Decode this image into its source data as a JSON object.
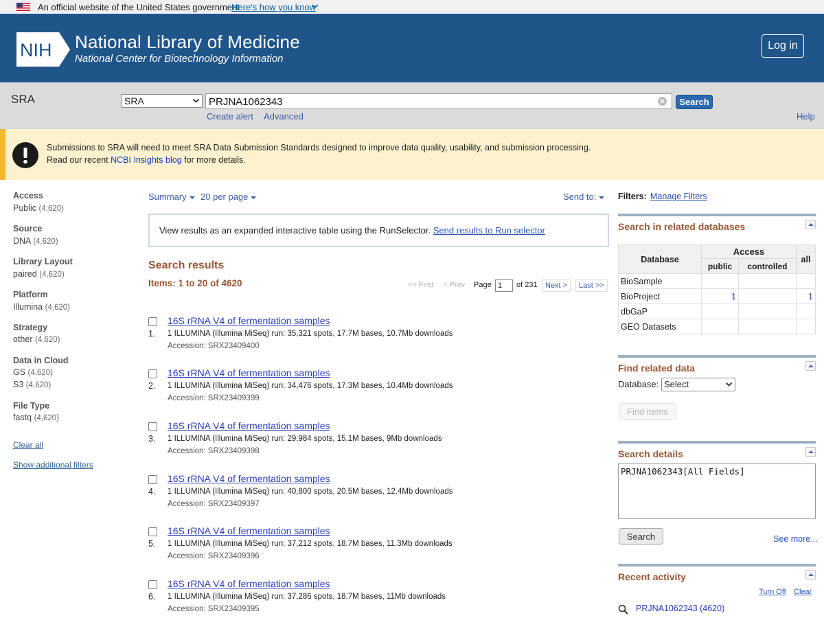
{
  "gov_banner": {
    "text": "An official website of the United States government",
    "link_text": "Here's how you know"
  },
  "header": {
    "logo_text": "NIH",
    "title": "National Library of Medicine",
    "subtitle": "National Center for Biotechnology Information",
    "login_label": "Log in",
    "brand_color": "#20558a"
  },
  "search_bar": {
    "database_label": "SRA",
    "database_selected": "SRA",
    "query": "PRJNA1062343",
    "search_button": "Search",
    "create_alert": "Create alert",
    "advanced": "Advanced",
    "help": "Help"
  },
  "notice": {
    "line1": "Submissions to SRA will need to meet SRA Data Submission Standards designed to improve data quality, usability, and submission processing.",
    "line2_prefix": "Read our recent ",
    "line2_link": "NCBI Insights blog",
    "line2_suffix": " for more details."
  },
  "filters": {
    "groups": [
      {
        "heading": "Access",
        "items": [
          {
            "label": "Public",
            "count": "(4,620)"
          }
        ]
      },
      {
        "heading": "Source",
        "items": [
          {
            "label": "DNA",
            "count": "(4,620)"
          }
        ]
      },
      {
        "heading": "Library Layout",
        "items": [
          {
            "label": "paired",
            "count": "(4,620)"
          }
        ]
      },
      {
        "heading": "Platform",
        "items": [
          {
            "label": "Illumina",
            "count": "(4,620)"
          }
        ]
      },
      {
        "heading": "Strategy",
        "items": [
          {
            "label": "other",
            "count": "(4,620)"
          }
        ]
      },
      {
        "heading": "Data in Cloud",
        "items": [
          {
            "label": "GS",
            "count": "(4,620)"
          },
          {
            "label": "S3",
            "count": "(4,620)"
          }
        ]
      },
      {
        "heading": "File Type",
        "items": [
          {
            "label": "fastq",
            "count": "(4,620)"
          }
        ]
      }
    ],
    "clear_all": "Clear all",
    "show_additional": "Show additional filters"
  },
  "results": {
    "format": "Summary",
    "per_page": "20 per page",
    "send_to": "Send to:",
    "runselector_text": "View results as an expanded interactive table using the RunSelector.",
    "runselector_link": "Send results to Run selector",
    "heading": "Search results",
    "items_count": "Items: 1 to 20 of 4620",
    "pager": {
      "first": "<< First",
      "prev": "< Prev",
      "page_label": "Page",
      "page_value": "1",
      "of_pages": "of 231",
      "next": "Next >",
      "last": "Last >>"
    },
    "items": [
      {
        "num": "1.",
        "title": "16S rRNA V4 of fermentation samples",
        "desc": "1 ILLUMINA (Illumina MiSeq) run: 35,321 spots, 17.7M bases, 10.7Mb downloads",
        "accession": "Accession: SRX23409400"
      },
      {
        "num": "2.",
        "title": "16S rRNA V4 of fermentation samples",
        "desc": "1 ILLUMINA (Illumina MiSeq) run: 34,476 spots, 17.3M bases, 10.4Mb downloads",
        "accession": "Accession: SRX23409399"
      },
      {
        "num": "3.",
        "title": "16S rRNA V4 of fermentation samples",
        "desc": "1 ILLUMINA (Illumina MiSeq) run: 29,984 spots, 15.1M bases, 9Mb downloads",
        "accession": "Accession: SRX23409398"
      },
      {
        "num": "4.",
        "title": "16S rRNA V4 of fermentation samples",
        "desc": "1 ILLUMINA (Illumina MiSeq) run: 40,800 spots, 20.5M bases, 12.4Mb downloads",
        "accession": "Accession: SRX23409397"
      },
      {
        "num": "5.",
        "title": "16S rRNA V4 of fermentation samples",
        "desc": "1 ILLUMINA (Illumina MiSeq) run: 37,212 spots, 18.7M bases, 11.3Mb downloads",
        "accession": "Accession: SRX23409396"
      },
      {
        "num": "6.",
        "title": "16S rRNA V4 of fermentation samples",
        "desc": "1 ILLUMINA (Illumina MiSeq) run: 37,286 spots, 18.7M bases, 11Mb downloads",
        "accession": "Accession: SRX23409395"
      }
    ]
  },
  "right": {
    "filters_label": "Filters:",
    "manage_filters": "Manage Filters",
    "related_db": {
      "title": "Search in related databases",
      "col_database": "Database",
      "col_access": "Access",
      "col_public": "public",
      "col_controlled": "controlled",
      "col_all": "all",
      "rows": [
        {
          "name": "BioSample",
          "public": "",
          "controlled": "",
          "all": ""
        },
        {
          "name": "BioProject",
          "public": "1",
          "controlled": "",
          "all": "1"
        },
        {
          "name": "dbGaP",
          "public": "",
          "controlled": "",
          "all": ""
        },
        {
          "name": "GEO Datasets",
          "public": "",
          "controlled": "",
          "all": ""
        }
      ]
    },
    "find_related": {
      "title": "Find related data",
      "database_label": "Database:",
      "database_selected": "Select",
      "find_items": "Find items"
    },
    "search_details": {
      "title": "Search details",
      "query": "PRJNA1062343[All Fields]",
      "search_button": "Search",
      "see_more": "See more..."
    },
    "recent_activity": {
      "title": "Recent activity",
      "turn_off": "Turn Off",
      "clear": "Clear",
      "item": "PRJNA1062343 (4620)"
    }
  }
}
